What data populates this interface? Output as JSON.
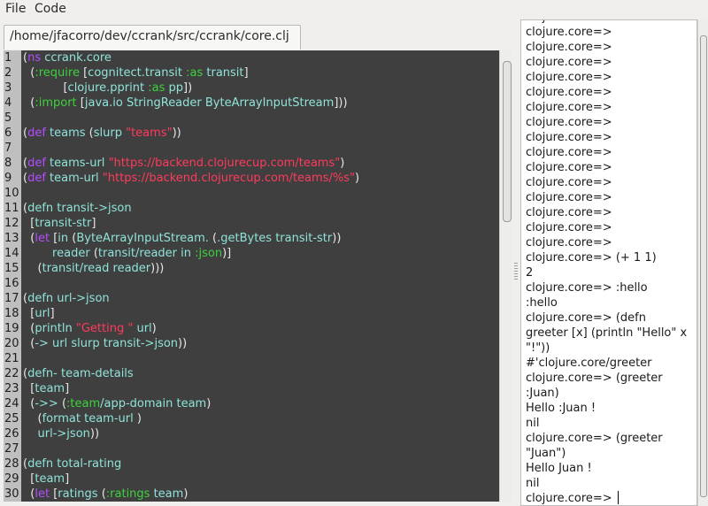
{
  "menu": {
    "file": "File",
    "code": "Code"
  },
  "tab": {
    "title": "/home/jfacorro/dev/ccrank/src/ccrank/core.clj"
  },
  "editor": {
    "line_numbers": [
      "1",
      "2",
      "3",
      "4",
      "5",
      "6",
      "7",
      "8",
      "9",
      "10",
      "11",
      "12",
      "13",
      "14",
      "15",
      "16",
      "17",
      "18",
      "19",
      "20",
      "21",
      "22",
      "23",
      "24",
      "25",
      "26",
      "27",
      "28",
      "29",
      "30"
    ],
    "lines": [
      [
        [
          "paren",
          "("
        ],
        [
          "kw",
          "ns"
        ],
        [
          "sym",
          " ccrank.core"
        ]
      ],
      [
        [
          "sym",
          "  "
        ],
        [
          "paren",
          "("
        ],
        [
          "key",
          ":require"
        ],
        [
          "sym",
          " "
        ],
        [
          "paren",
          "["
        ],
        [
          "sym",
          "cognitect.transit "
        ],
        [
          "key",
          ":as"
        ],
        [
          "sym",
          " transit"
        ],
        [
          "paren",
          "]"
        ]
      ],
      [
        [
          "sym",
          "           "
        ],
        [
          "paren",
          "["
        ],
        [
          "sym",
          "clojure.pprint "
        ],
        [
          "key",
          ":as"
        ],
        [
          "sym",
          " pp"
        ],
        [
          "paren",
          "])"
        ]
      ],
      [
        [
          "sym",
          "  "
        ],
        [
          "paren",
          "("
        ],
        [
          "key",
          ":import"
        ],
        [
          "sym",
          " "
        ],
        [
          "paren",
          "["
        ],
        [
          "sym",
          "java.io StringReader ByteArrayInputStream"
        ],
        [
          "paren",
          "]))"
        ]
      ],
      [],
      [
        [
          "paren",
          "("
        ],
        [
          "kw",
          "def"
        ],
        [
          "sym",
          " teams "
        ],
        [
          "paren",
          "("
        ],
        [
          "sym",
          "slurp "
        ],
        [
          "str",
          "\"teams\""
        ],
        [
          "paren",
          "))"
        ]
      ],
      [],
      [
        [
          "paren",
          "("
        ],
        [
          "kw",
          "def"
        ],
        [
          "sym",
          " teams-url "
        ],
        [
          "str",
          "\"https://backend.clojurecup.com/teams\""
        ],
        [
          "paren",
          ")"
        ]
      ],
      [
        [
          "paren",
          "("
        ],
        [
          "kw",
          "def"
        ],
        [
          "sym",
          " team-url "
        ],
        [
          "str",
          "\"https://backend.clojurecup.com/teams/%s\""
        ],
        [
          "paren",
          ")"
        ]
      ],
      [],
      [
        [
          "paren",
          "("
        ],
        [
          "sym",
          "defn transit->json"
        ]
      ],
      [
        [
          "sym",
          "  "
        ],
        [
          "paren",
          "["
        ],
        [
          "sym",
          "transit-str"
        ],
        [
          "paren",
          "]"
        ]
      ],
      [
        [
          "sym",
          "  "
        ],
        [
          "paren",
          "("
        ],
        [
          "kw",
          "let"
        ],
        [
          "sym",
          " "
        ],
        [
          "paren",
          "["
        ],
        [
          "sym",
          "in "
        ],
        [
          "paren",
          "("
        ],
        [
          "sym",
          "ByteArrayInputStream. "
        ],
        [
          "paren",
          "("
        ],
        [
          "sym",
          ".getBytes transit-str"
        ],
        [
          "paren",
          "))"
        ]
      ],
      [
        [
          "sym",
          "        reader "
        ],
        [
          "paren",
          "("
        ],
        [
          "sym",
          "transit/reader in "
        ],
        [
          "key",
          ":json"
        ],
        [
          "paren",
          ")]"
        ]
      ],
      [
        [
          "sym",
          "    "
        ],
        [
          "paren",
          "("
        ],
        [
          "sym",
          "transit/read reader"
        ],
        [
          "paren",
          ")))"
        ]
      ],
      [],
      [
        [
          "paren",
          "("
        ],
        [
          "sym",
          "defn url->json"
        ]
      ],
      [
        [
          "sym",
          "  "
        ],
        [
          "paren",
          "["
        ],
        [
          "sym",
          "url"
        ],
        [
          "paren",
          "]"
        ]
      ],
      [
        [
          "sym",
          "  "
        ],
        [
          "paren",
          "("
        ],
        [
          "sym",
          "println "
        ],
        [
          "str",
          "\"Getting \""
        ],
        [
          "sym",
          " url"
        ],
        [
          "paren",
          ")"
        ]
      ],
      [
        [
          "sym",
          "  "
        ],
        [
          "paren",
          "("
        ],
        [
          "sym",
          "-> url slurp transit->json"
        ],
        [
          "paren",
          "))"
        ]
      ],
      [],
      [
        [
          "paren",
          "("
        ],
        [
          "sym",
          "defn- team-details"
        ]
      ],
      [
        [
          "sym",
          "  "
        ],
        [
          "paren",
          "["
        ],
        [
          "sym",
          "team"
        ],
        [
          "paren",
          "]"
        ]
      ],
      [
        [
          "sym",
          "  "
        ],
        [
          "paren",
          "("
        ],
        [
          "sym",
          "->> "
        ],
        [
          "paren",
          "("
        ],
        [
          "key",
          ":team"
        ],
        [
          "sym",
          "/app-domain team"
        ],
        [
          "paren",
          ")"
        ]
      ],
      [
        [
          "sym",
          "    "
        ],
        [
          "paren",
          "("
        ],
        [
          "sym",
          "format team-url "
        ],
        [
          "paren",
          ")"
        ]
      ],
      [
        [
          "sym",
          "    url->json"
        ],
        [
          "paren",
          "))"
        ]
      ],
      [],
      [
        [
          "paren",
          "("
        ],
        [
          "sym",
          "defn total-rating"
        ]
      ],
      [
        [
          "sym",
          "  "
        ],
        [
          "paren",
          "["
        ],
        [
          "sym",
          "team"
        ],
        [
          "paren",
          "]"
        ]
      ],
      [
        [
          "sym",
          "  "
        ],
        [
          "paren",
          "("
        ],
        [
          "kw",
          "let"
        ],
        [
          "sym",
          " "
        ],
        [
          "paren",
          "["
        ],
        [
          "sym",
          "ratings "
        ],
        [
          "paren",
          "("
        ],
        [
          "key",
          ":ratings"
        ],
        [
          "sym",
          " team"
        ],
        [
          "paren",
          ")"
        ]
      ]
    ]
  },
  "repl": {
    "lines": [
      "clojure.core=>",
      "clojure.core=>",
      "clojure.core=>",
      "clojure.core=>",
      "clojure.core=>",
      "clojure.core=>",
      "clojure.core=>",
      "clojure.core=>",
      "clojure.core=>",
      "clojure.core=>",
      "clojure.core=>",
      "clojure.core=>",
      "clojure.core=>",
      "clojure.core=>",
      "clojure.core=>",
      "clojure.core=>",
      "clojure.core=> (+ 1 1)",
      "2",
      "clojure.core=> :hello",
      ":hello",
      "clojure.core=> (defn",
      "greeter [x] (println \"Hello\" x",
      "\"!\"))",
      "#'clojure.core/greeter",
      "clojure.core=> (greeter",
      ":Juan)",
      "Hello :Juan !",
      "nil",
      "clojure.core=> (greeter",
      "\"Juan\")",
      "Hello Juan !",
      "nil",
      "clojure.core=> "
    ]
  },
  "colors": {
    "editor_bg": "#3f3f3f",
    "keyword": "#b34dff",
    "keyword_literal": "#3dd23d",
    "string": "#ff3a5c",
    "symbol": "#8fe3d9"
  }
}
